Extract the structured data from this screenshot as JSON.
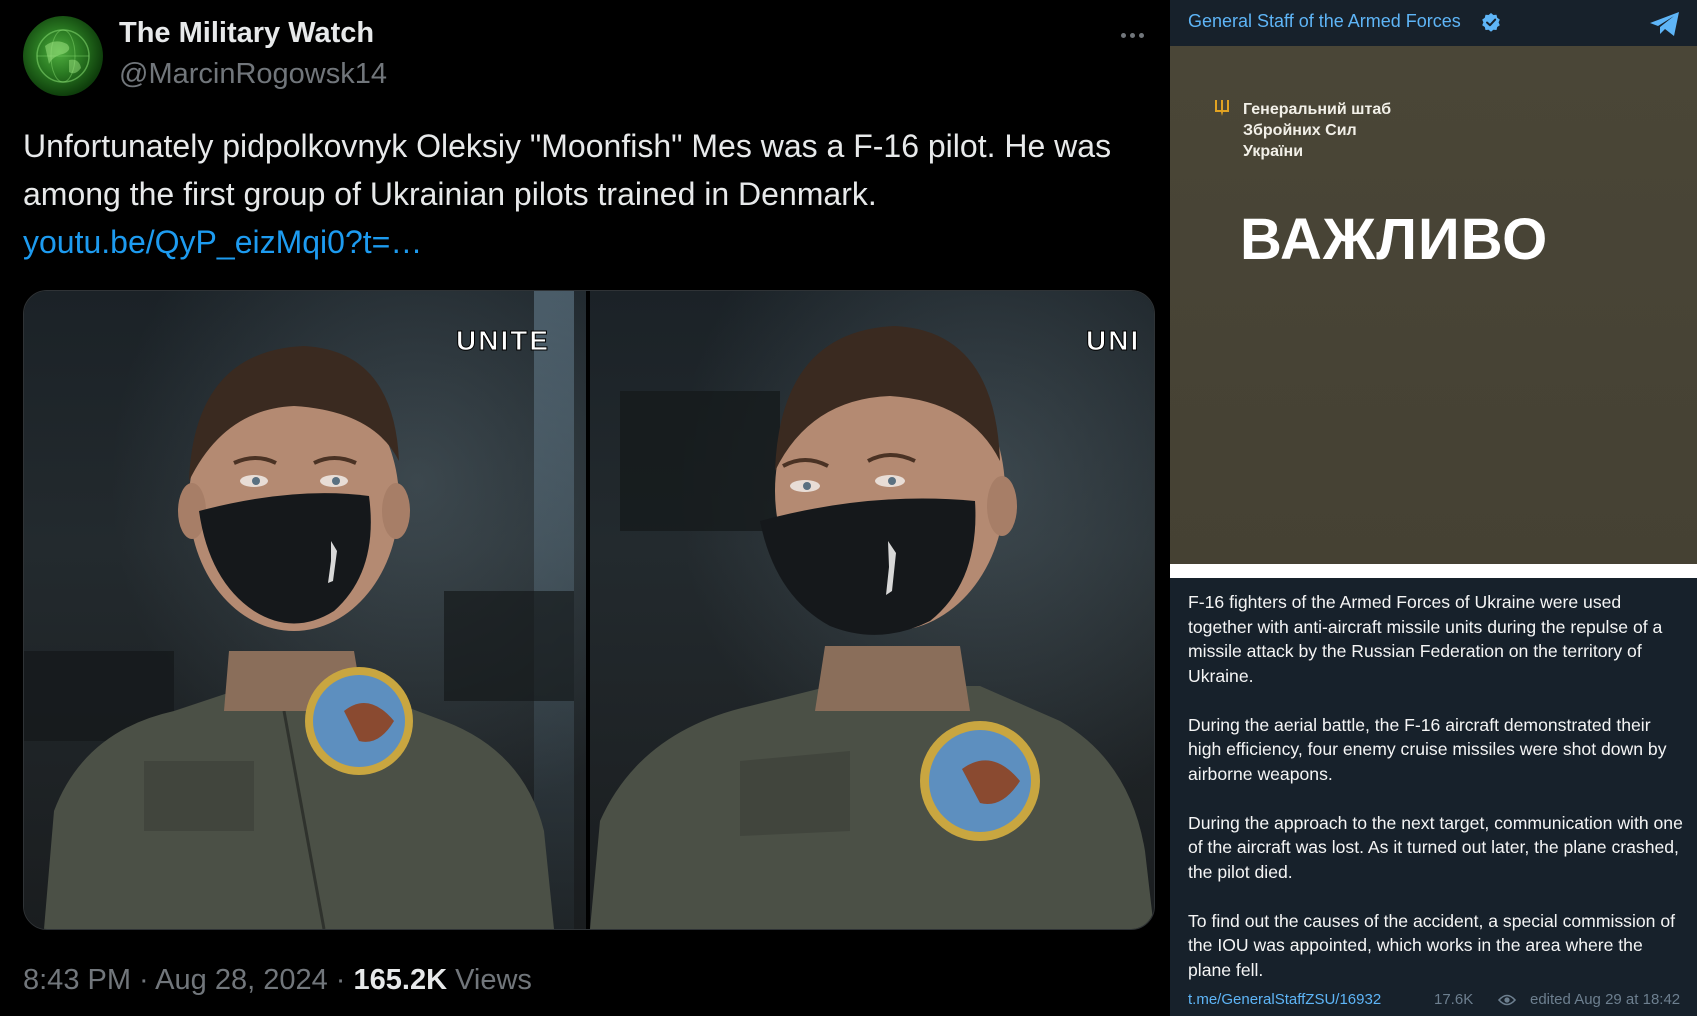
{
  "tweet": {
    "display_name": "The Military Watch",
    "handle": "@MarcinRogowsk14",
    "text": "Unfortunately pidpolkovnyk Oleksiy \"Moonfish\" Mes was a F-16 pilot. He was among the first group of Ukrainian pilots trained in Denmark.",
    "link": "youtu.be/QyP_eizMqi0?t=…",
    "media": {
      "watermark_left": "UNITE",
      "watermark_right": "UNI"
    },
    "time": "8:43 PM",
    "separator": " · ",
    "date": "Aug 28, 2024",
    "views_count": "165.2K",
    "views_label": "Views",
    "more_icon": "more-dots-icon"
  },
  "telegram": {
    "channel_name": "General Staff of the Armed Forces",
    "verified_icon": "verified-badge-icon",
    "app_icon": "telegram-plane-icon",
    "image": {
      "org_label": "Генеральний штаб\nЗбройних Сил\nУкраїни",
      "headline": "ВАЖЛИВО",
      "emblem_icon": "trident-icon"
    },
    "body": [
      "F-16 fighters of the Armed Forces of Ukraine were used together with anti-aircraft missile units during the repulse of a missile attack by the Russian Federation on the territory of Ukraine.",
      "During the aerial battle, the F-16 aircraft demonstrated their high efficiency, four enemy cruise missiles were shot down by airborne weapons.",
      "During the approach to the next target, communication with one of the aircraft was lost. As it turned out later, the plane crashed, the pilot died.",
      "To find out the causes of the accident, a special commission of the IOU was appointed, which works in the area where the plane fell."
    ],
    "post_link": "t.me/GeneralStaffZSU/16932",
    "views": "17.6K",
    "edited": "edited  Aug 29 at 18:42"
  },
  "colors": {
    "tweet_bg": "#000000",
    "link_blue": "#1d9bf0",
    "tg_bg": "#17212b",
    "tg_accent": "#5eb5f7",
    "image_olive": "#4a4637"
  }
}
